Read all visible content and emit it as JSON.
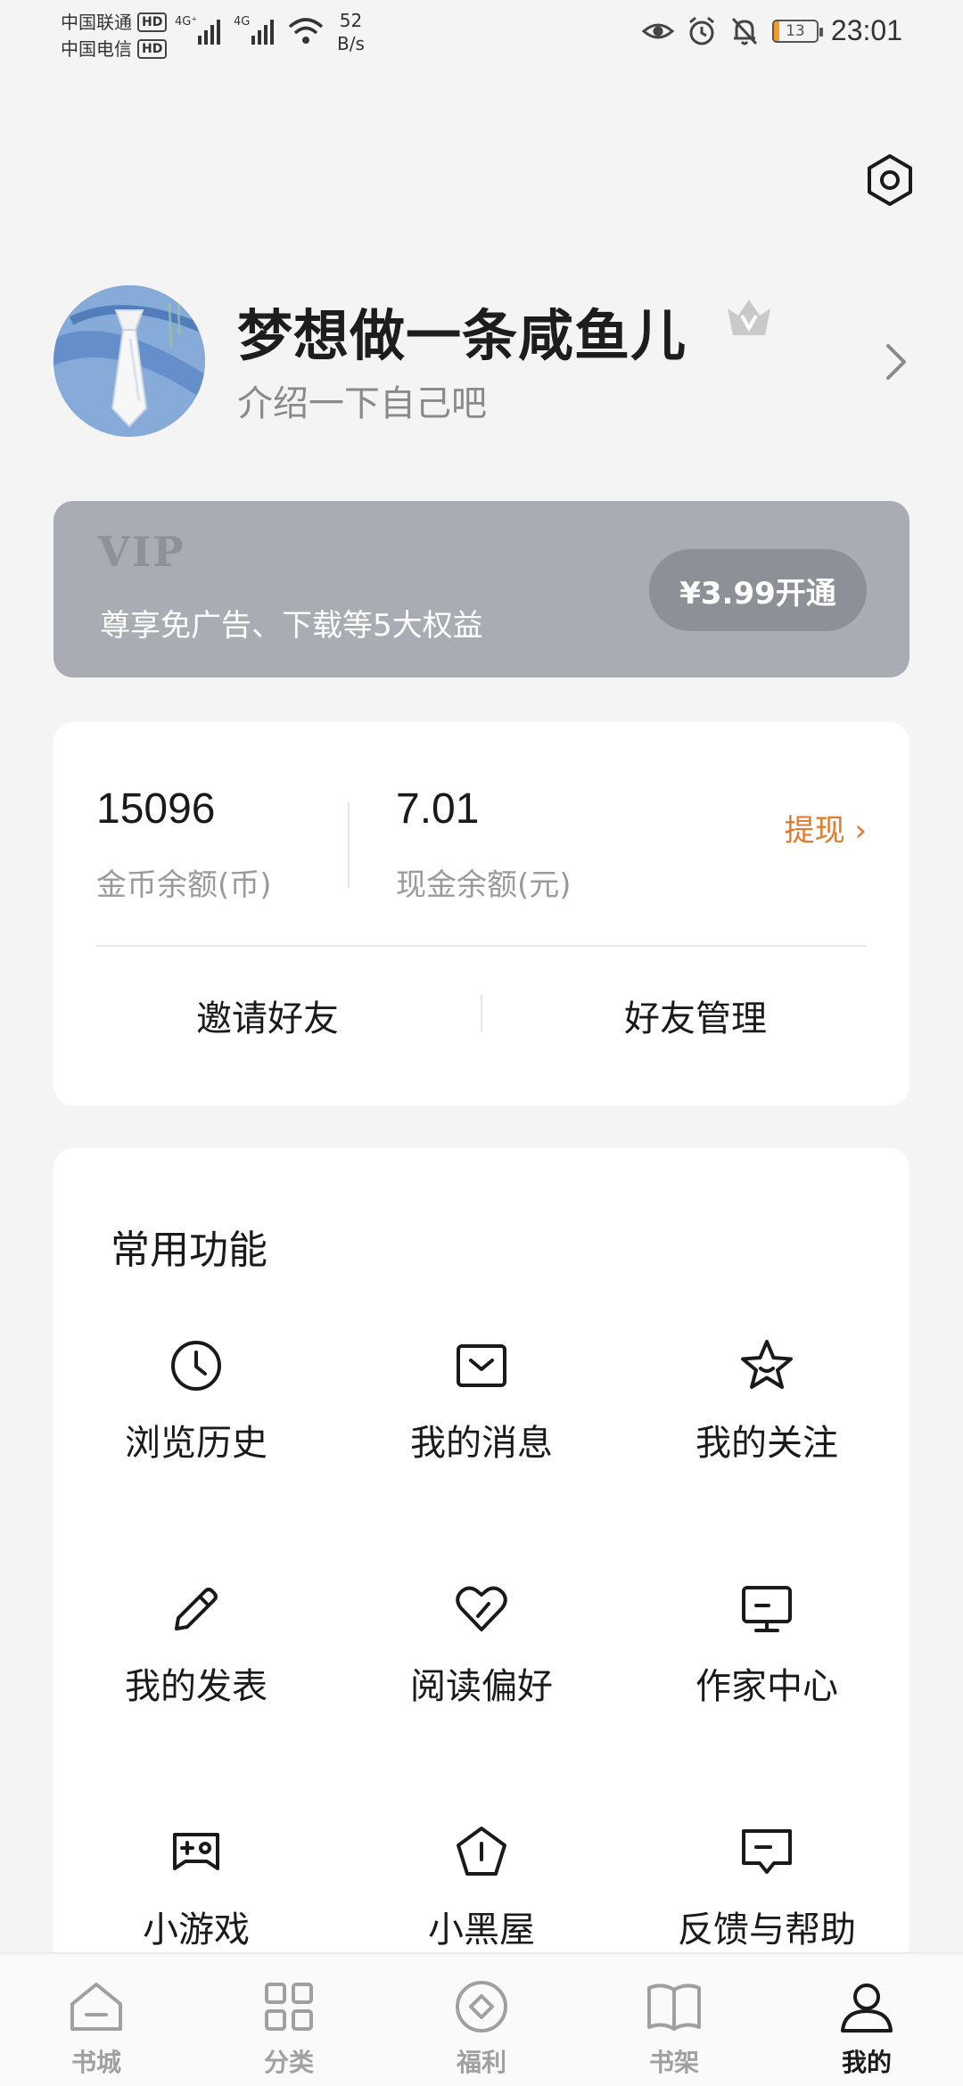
{
  "status_bar": {
    "carrier_1": "中国联通",
    "carrier_2": "中国电信",
    "hd_badge": "HD",
    "net_1": "4G⁺",
    "net_2": "4G",
    "speed_value": "52",
    "speed_unit": "B/s",
    "battery": "13",
    "time": "23:01"
  },
  "profile": {
    "username": "梦想做一条咸鱼儿",
    "bio": "介绍一下自己吧"
  },
  "vip": {
    "logo": "VIP",
    "benefits": "尊享免广告、下载等5大权益",
    "button": "¥3.99开通"
  },
  "wallet": {
    "coins_value": "15096",
    "coins_label": "金币余额(币)",
    "cash_value": "7.01",
    "cash_label": "现金余额(元)",
    "withdraw": "提现 ›",
    "invite": "邀请好友",
    "manage_friends": "好友管理"
  },
  "functions": {
    "title": "常用功能",
    "items": [
      {
        "label": "浏览历史",
        "icon": "clock-icon"
      },
      {
        "label": "我的消息",
        "icon": "message-icon"
      },
      {
        "label": "我的关注",
        "icon": "star-icon"
      },
      {
        "label": "我的发表",
        "icon": "pencil-icon"
      },
      {
        "label": "阅读偏好",
        "icon": "heart-icon"
      },
      {
        "label": "作家中心",
        "icon": "monitor-icon"
      },
      {
        "label": "小游戏",
        "icon": "gamepad-icon"
      },
      {
        "label": "小黑屋",
        "icon": "pentagon-icon"
      },
      {
        "label": "反馈与帮助",
        "icon": "feedback-icon"
      }
    ]
  },
  "bottom_nav": {
    "items": [
      {
        "label": "书城",
        "icon": "home-icon",
        "active": false
      },
      {
        "label": "分类",
        "icon": "grid-icon",
        "active": false
      },
      {
        "label": "福利",
        "icon": "coin-icon",
        "active": false
      },
      {
        "label": "书架",
        "icon": "book-icon",
        "active": false
      },
      {
        "label": "我的",
        "icon": "person-icon",
        "active": true
      }
    ]
  },
  "colors": {
    "accent_orange": "#e07a2e",
    "vip_card": "#a9adb3",
    "background": "#f4f4f4"
  }
}
